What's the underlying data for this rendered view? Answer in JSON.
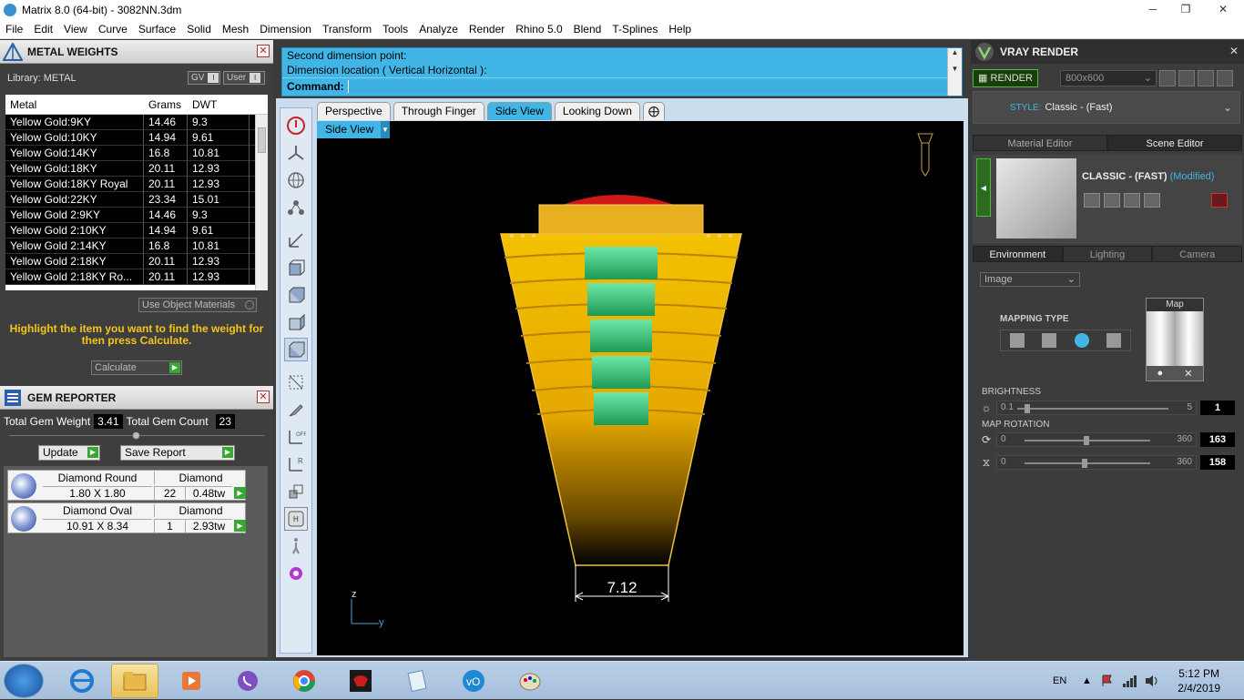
{
  "window": {
    "title": "Matrix 8.0 (64-bit) - 3082NN.3dm"
  },
  "menu": [
    "File",
    "Edit",
    "View",
    "Curve",
    "Surface",
    "Solid",
    "Mesh",
    "Dimension",
    "Transform",
    "Tools",
    "Analyze",
    "Render",
    "Rhino 5.0",
    "Blend",
    "T-Splines",
    "Help"
  ],
  "metal_weights": {
    "title": "METAL WEIGHTS",
    "library_label": "Library: METAL",
    "gv_label": "GV",
    "user_label": "User",
    "columns": [
      "Metal",
      "Grams",
      "DWT"
    ],
    "rows": [
      [
        "Yellow Gold:9KY",
        "14.46",
        "9.3"
      ],
      [
        "Yellow Gold:10KY",
        "14.94",
        "9.61"
      ],
      [
        "Yellow Gold:14KY",
        "16.8",
        "10.81"
      ],
      [
        "Yellow Gold:18KY",
        "20.11",
        "12.93"
      ],
      [
        "Yellow Gold:18KY Royal",
        "20.11",
        "12.93"
      ],
      [
        "Yellow Gold:22KY",
        "23.34",
        "15.01"
      ],
      [
        "Yellow Gold 2:9KY",
        "14.46",
        "9.3"
      ],
      [
        "Yellow Gold 2:10KY",
        "14.94",
        "9.61"
      ],
      [
        "Yellow Gold 2:14KY",
        "16.8",
        "10.81"
      ],
      [
        "Yellow Gold 2:18KY",
        "20.11",
        "12.93"
      ],
      [
        "Yellow Gold 2:18KY Ro...",
        "20.11",
        "12.93"
      ]
    ],
    "use_object_materials": "Use Object Materials",
    "hint": "Highlight the item you want to find the weight for then press Calculate.",
    "calculate": "Calculate"
  },
  "gem_reporter": {
    "title": "GEM REPORTER",
    "total_weight_label": "Total Gem Weight",
    "total_weight": "3.41",
    "total_count_label": "Total Gem Count",
    "total_count": "23",
    "update": "Update",
    "save_report": "Save Report",
    "gems": [
      {
        "name": "Diamond Round",
        "type": "Diamond",
        "size": "1.80 X 1.80",
        "count": "22",
        "tw": "0.48tw"
      },
      {
        "name": "Diamond Oval",
        "type": "Diamond",
        "size": "10.91 X 8.34",
        "count": "1",
        "tw": "2.93tw"
      }
    ]
  },
  "command": {
    "line1": "Second dimension point:",
    "line2": "Dimension location ( Vertical  Horizontal ):",
    "prompt": "Command:"
  },
  "viewport_tabs": [
    "Perspective",
    "Through Finger",
    "Side View",
    "Looking Down"
  ],
  "active_tab": "Side View",
  "viewport": {
    "label": "Side View",
    "dimension": "7.12",
    "axis_z": "z",
    "axis_y": "y"
  },
  "vray": {
    "title": "VRAY RENDER",
    "render_btn": "RENDER",
    "resolution": "800x600",
    "style_label": "STYLE:",
    "style_value": "Classic - (Fast)",
    "tabs": [
      "Material Editor",
      "Scene Editor"
    ],
    "scene_name": "CLASSIC - (FAST)",
    "scene_modified": "(Modified)",
    "env_tabs": [
      "Environment",
      "Lighting",
      "Camera"
    ],
    "image_select": "Image",
    "mapping_type": "MAPPING TYPE",
    "map_title": "Map",
    "brightness_label": "BRIGHTNESS",
    "brightness": {
      "min": "0.1",
      "max": "5",
      "value": "1",
      "fraction": 0.14
    },
    "map_rotation_label": "MAP ROTATION",
    "rot1": {
      "min": "0",
      "max": "360",
      "value": "163",
      "fraction": 0.45
    },
    "rot2": {
      "min": "0",
      "max": "360",
      "value": "158",
      "fraction": 0.44
    }
  },
  "taskbar": {
    "lang": "EN",
    "time": "5:12 PM",
    "date": "2/4/2019"
  }
}
